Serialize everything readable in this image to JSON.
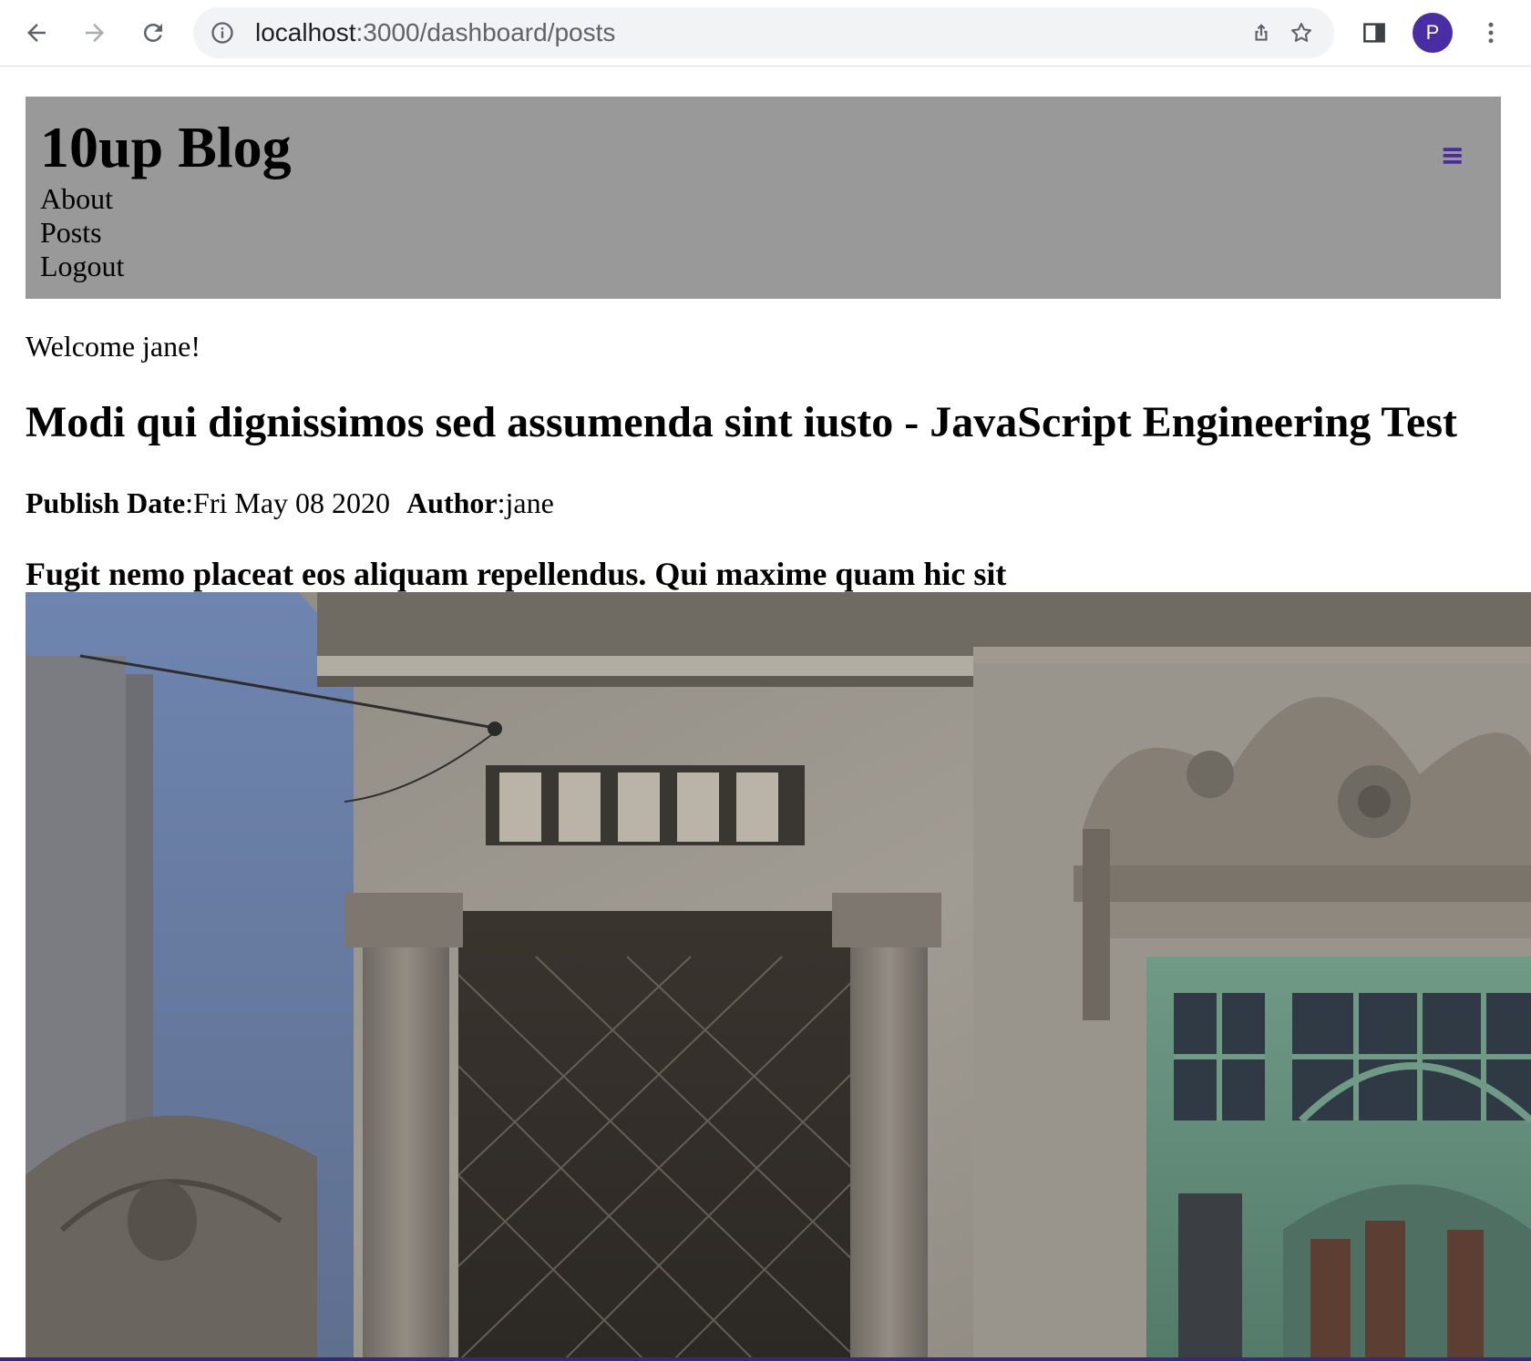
{
  "browser": {
    "back_icon": "arrow-left-icon",
    "forward_icon": "arrow-right-icon",
    "reload_icon": "reload-icon",
    "site_info_icon": "info-icon",
    "url_host": "localhost",
    "url_path": ":3000/dashboard/posts",
    "share_icon": "share-icon",
    "bookmark_icon": "star-icon",
    "side_panel_icon": "side-panel-icon",
    "profile_initial": "P",
    "menu_icon": "kebab-menu-icon",
    "accent_color": "#4a2ca3"
  },
  "header": {
    "title": "10up Blog",
    "nav": [
      {
        "label": "About"
      },
      {
        "label": "Posts"
      },
      {
        "label": "Logout"
      }
    ],
    "menu_toggle": "≡",
    "background": "#999999",
    "toggle_color": "#4b2aa0"
  },
  "main": {
    "welcome": "Welcome jane!",
    "post": {
      "title": "Modi qui dignissimos sed assumenda sint iusto - JavaScript Engineering Test",
      "publish_date_label": "Publish Date",
      "publish_date_value": ":Fri May 08 2020",
      "author_label": "Author",
      "author_value": ":jane",
      "excerpt": "Fugit nemo placeat eos aliquam repellendus. Qui maxime quam hic sit",
      "image_icon": "building-facade-image"
    }
  }
}
